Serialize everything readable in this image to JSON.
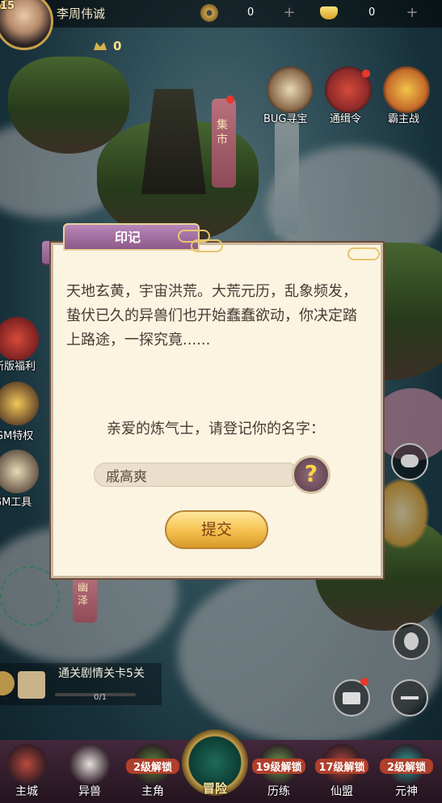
{
  "player": {
    "name": "李周伟诚",
    "level": "15",
    "power": "0"
  },
  "currency": [
    {
      "icon": "copper-coin-icon",
      "value": "0"
    },
    {
      "icon": "gold-ingot-icon",
      "value": "0"
    }
  ],
  "top_buttons": [
    {
      "label": "BUG寻宝",
      "icon": "treasure-scroll-icon"
    },
    {
      "label": "通缉令",
      "icon": "wanted-mask-icon"
    },
    {
      "label": "霸主战",
      "icon": "lion-mask-icon"
    }
  ],
  "map_sign": "集市",
  "map_sign_bottom": "幽泽",
  "left_buttons": [
    {
      "label": "新版福利",
      "icon": "gift-icon"
    },
    {
      "label": "GM特权",
      "icon": "gm-privilege-icon"
    },
    {
      "label": "GM工具",
      "icon": "gm-tool-icon"
    }
  ],
  "dialog": {
    "title": "印记",
    "story": "天地玄黄，宇宙洪荒。大荒元历，乱象频发，蛰伏已久的异兽们也开始蠢蠢欲动，你决定踏上路途，一探究竟......",
    "prompt": "亲爱的炼气士，请登记你的名字：",
    "name_value": "戚高爽",
    "help_icon": "?",
    "submit_label": "提交"
  },
  "quest": {
    "text": "通关剧情关卡5关",
    "progress_label": "0/1",
    "progress": 0
  },
  "nav": [
    {
      "label": "主城",
      "lock": ""
    },
    {
      "label": "异兽",
      "lock": ""
    },
    {
      "label": "主角",
      "lock": "2级解锁"
    },
    {
      "label": "冒险",
      "lock": ""
    },
    {
      "label": "历练",
      "lock": "19级解锁"
    },
    {
      "label": "仙盟",
      "lock": "17级解锁"
    },
    {
      "label": "元神",
      "lock": "2级解锁"
    }
  ]
}
